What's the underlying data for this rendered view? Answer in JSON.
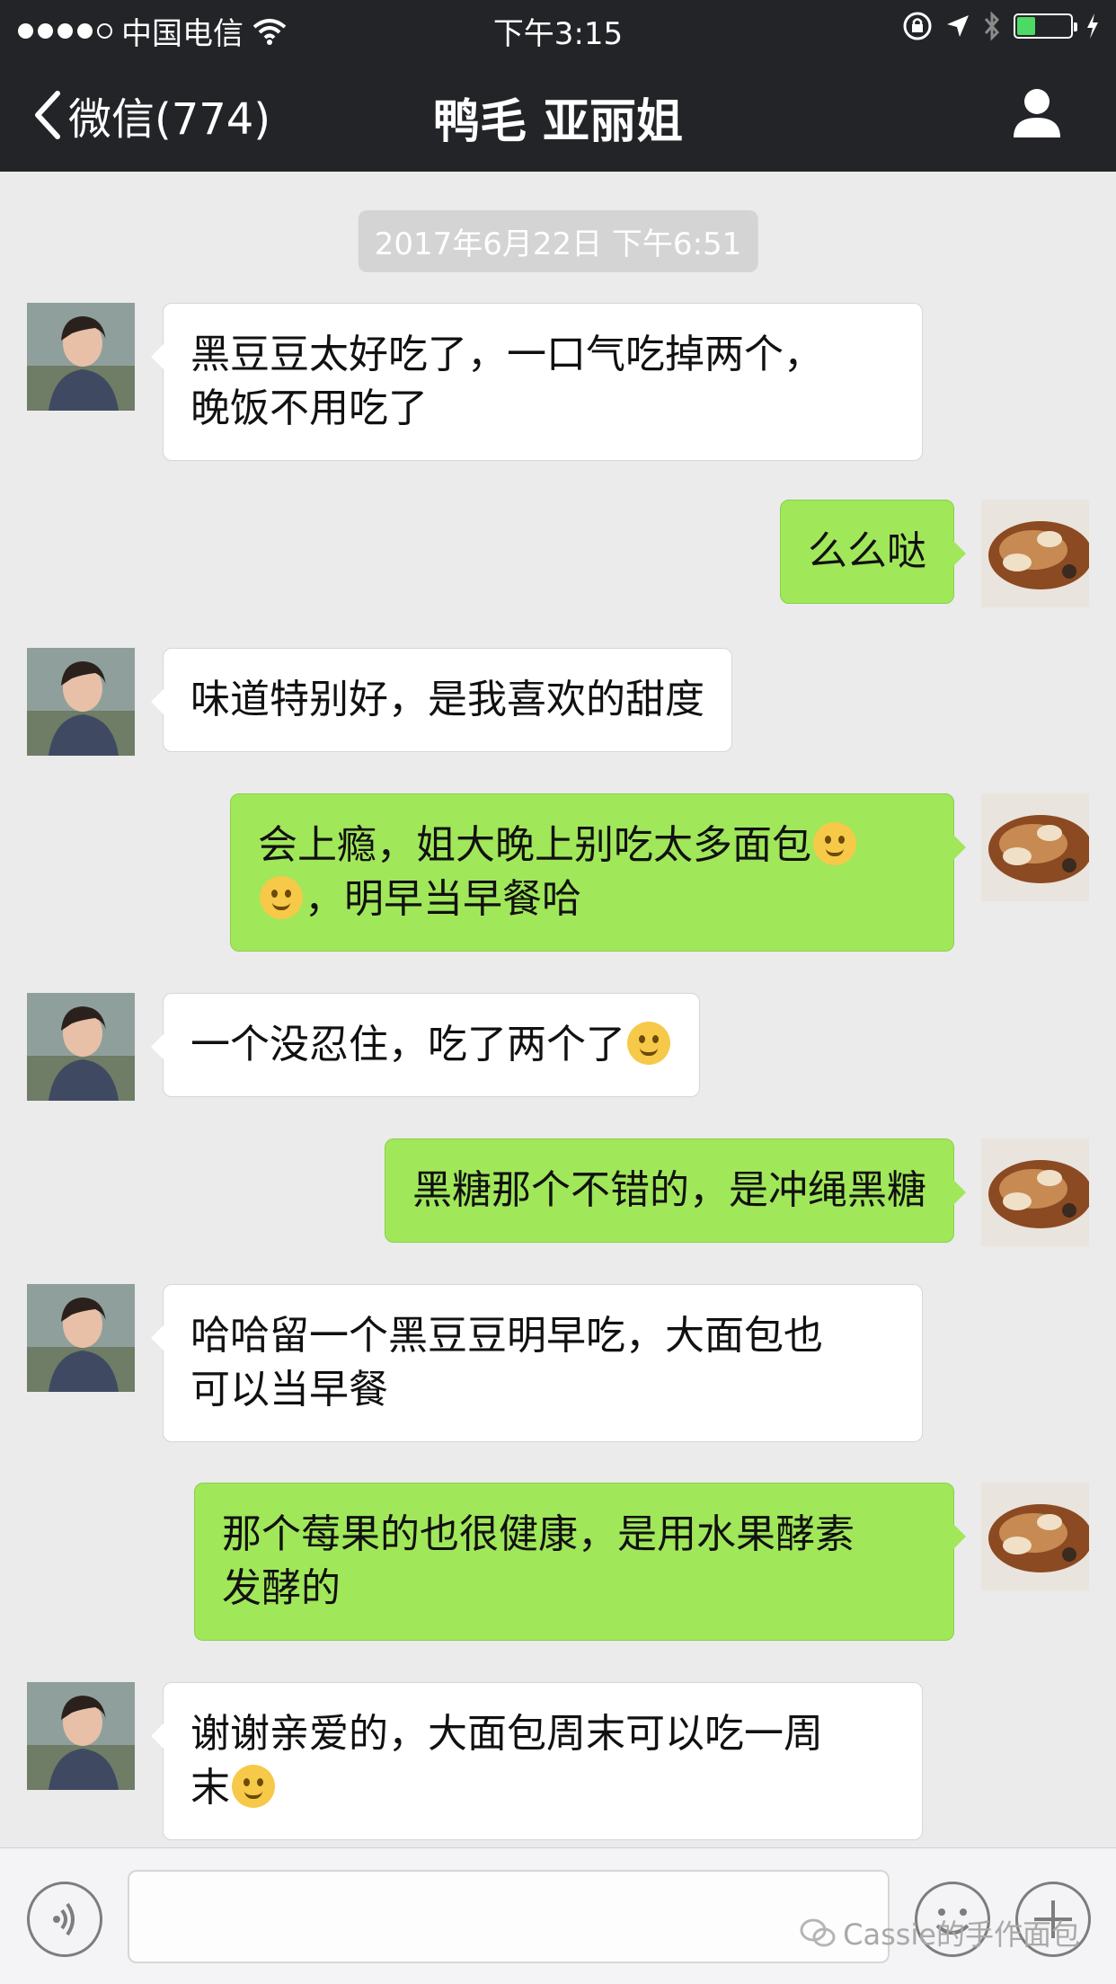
{
  "status_bar": {
    "carrier": "中国电信",
    "time": "下午3:15"
  },
  "nav": {
    "back_label": "微信(774)",
    "title": "鸭毛 亚丽姐"
  },
  "chat": {
    "timestamp": "2017年6月22日 下午6:51",
    "messages": [
      {
        "side": "in",
        "lines": [
          "黑豆豆太好吃了，一口气吃掉两个，",
          "晚饭不用吃了"
        ]
      },
      {
        "side": "out",
        "lines": [
          "么么哒"
        ]
      },
      {
        "side": "in",
        "lines": [
          "味道特别好，是我喜欢的甜度"
        ]
      },
      {
        "side": "out",
        "line1": "会上瘾，姐大晚上别吃太多面包",
        "line2": "，明早当早餐哈"
      },
      {
        "side": "in",
        "line1": "一个没忍住，吃了两个了"
      },
      {
        "side": "out",
        "lines": [
          "黑糖那个不错的，是冲绳黑糖"
        ]
      },
      {
        "side": "in",
        "lines": [
          "哈哈留一个黑豆豆明早吃，大面包也",
          "可以当早餐"
        ]
      },
      {
        "side": "out",
        "lines": [
          "那个莓果的也很健康，是用水果酵素",
          "发酵的"
        ]
      },
      {
        "side": "in",
        "line1": "谢谢亲爱的，大面包周末可以吃一周",
        "line2": "末"
      }
    ]
  },
  "input_bar": {
    "watermark": "Cassie的手作面包"
  },
  "icons": {
    "back": "chevron-left-icon",
    "profile": "person-icon",
    "voice": "voice-icon",
    "emoji": "smiley-icon",
    "plus": "plus-icon",
    "wechat": "wechat-icon"
  },
  "colors": {
    "nav_bg": "#222427",
    "chat_bg": "#ebebeb",
    "incoming_bubble": "#ffffff",
    "outgoing_bubble": "#a0e75a"
  }
}
